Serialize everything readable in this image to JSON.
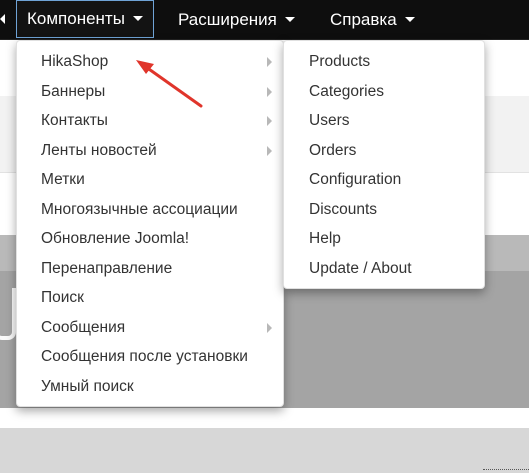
{
  "navbar": {
    "items": [
      {
        "label": "Компоненты",
        "active": true
      },
      {
        "label": "Расширения",
        "active": false
      },
      {
        "label": "Справка",
        "active": false
      }
    ]
  },
  "components_menu": {
    "items": [
      {
        "label": "HikaShop",
        "submenu": true
      },
      {
        "label": "Баннеры",
        "submenu": true
      },
      {
        "label": "Контакты",
        "submenu": true
      },
      {
        "label": "Ленты новостей",
        "submenu": true
      },
      {
        "label": "Метки",
        "submenu": false
      },
      {
        "label": "Многоязычные ассоциации",
        "submenu": false
      },
      {
        "label": "Обновление Joomla!",
        "submenu": false
      },
      {
        "label": "Перенаправление",
        "submenu": false
      },
      {
        "label": "Поиск",
        "submenu": false
      },
      {
        "label": "Сообщения",
        "submenu": true
      },
      {
        "label": "Сообщения после установки",
        "submenu": false
      },
      {
        "label": "Умный поиск",
        "submenu": false
      }
    ]
  },
  "hikashop_menu": {
    "items": [
      {
        "label": "Products"
      },
      {
        "label": "Categories"
      },
      {
        "label": "Users"
      },
      {
        "label": "Orders"
      },
      {
        "label": "Configuration"
      },
      {
        "label": "Discounts"
      },
      {
        "label": "Help"
      },
      {
        "label": "Update / About"
      }
    ]
  },
  "colors": {
    "navbar_bg": "#0e0e0e",
    "active_border": "#6fa3d6",
    "menu_text": "#333333",
    "annotation_arrow": "#e0352b"
  },
  "icons": {
    "caret": "caret-down-icon",
    "submenu": "chevron-right-icon",
    "annotation": "red-arrow-annotation"
  }
}
